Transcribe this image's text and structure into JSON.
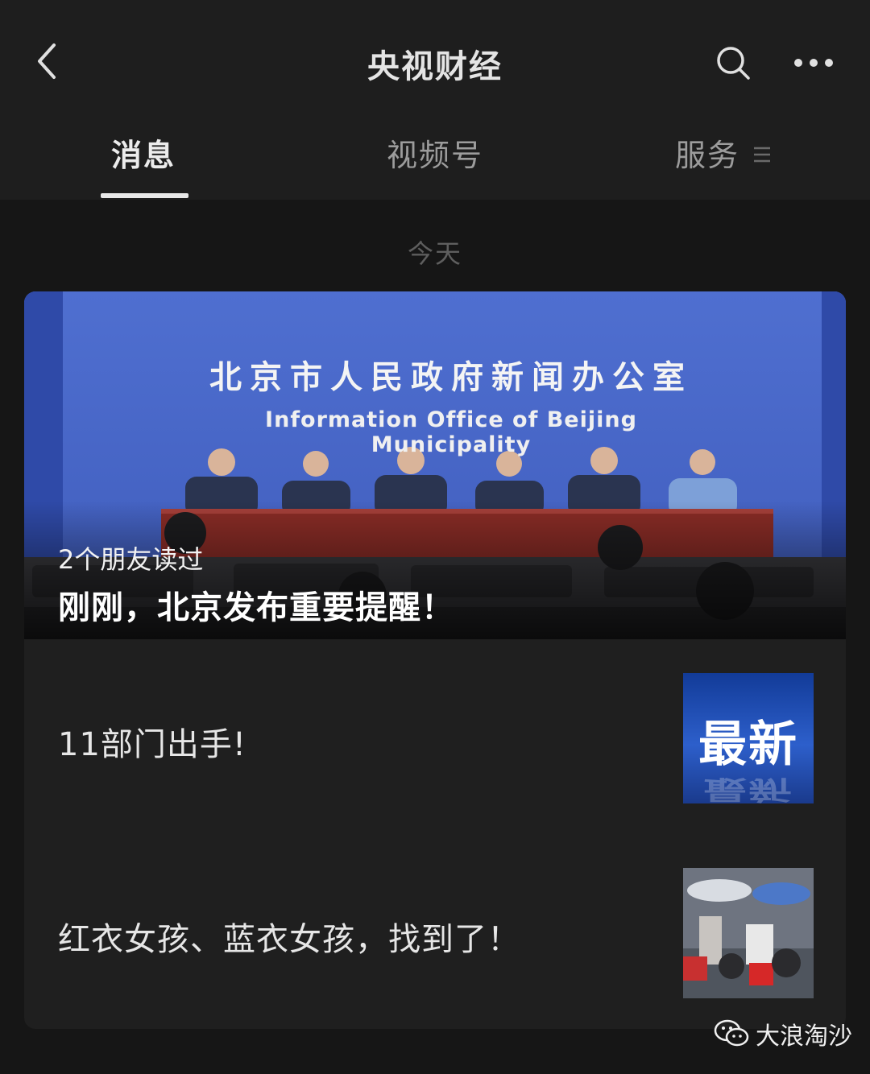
{
  "header": {
    "title": "央视财经",
    "back_icon": "chevron-left-icon",
    "search_icon": "search-icon",
    "more_icon": "more-dots-icon"
  },
  "tabs": [
    {
      "label": "消息",
      "active": true
    },
    {
      "label": "视频号",
      "active": false
    },
    {
      "label": "服务",
      "active": false,
      "icon": "menu-lines-icon"
    }
  ],
  "date_label": "今天",
  "hero": {
    "image_banner_cn": "北京市人民政府新闻办公室",
    "image_banner_en": "Information Office of Beijing Municipality",
    "readers": "2个朋友读过",
    "title": "刚刚，北京发布重要提醒！"
  },
  "articles": [
    {
      "title": "11部门出手!",
      "thumb_text": "最新"
    },
    {
      "title": "红衣女孩、蓝衣女孩，找到了！"
    }
  ],
  "watermark": {
    "text": "大浪淘沙",
    "icon": "wechat-icon"
  },
  "colors": {
    "background": "#161616",
    "bar": "#1e1e1e",
    "card": "#1f1f1f",
    "press_backdrop": "#4a68c8",
    "table_red": "#8a2c26"
  }
}
